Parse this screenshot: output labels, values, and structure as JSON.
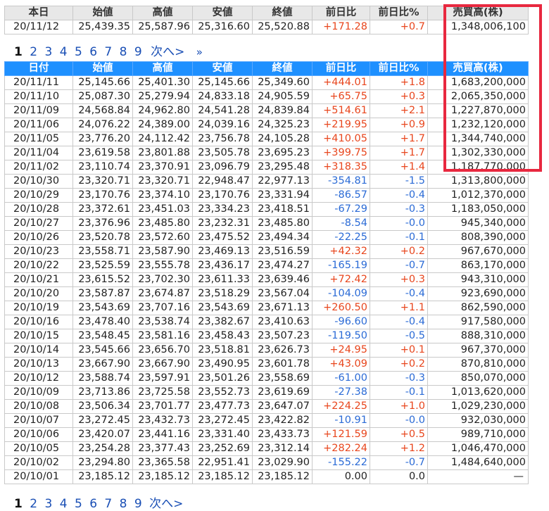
{
  "today": {
    "headers": [
      "本日",
      "始値",
      "高値",
      "安値",
      "終値",
      "前日比",
      "前日比%",
      "売買高(株)"
    ],
    "row": [
      "20/11/12",
      "25,439.35",
      "25,587.96",
      "25,316.60",
      "25,520.88",
      "+171.28",
      "+0.7",
      "1,348,006,100"
    ]
  },
  "pager": {
    "pages": [
      "1",
      "2",
      "3",
      "4",
      "5",
      "6",
      "7",
      "8",
      "9"
    ],
    "current": "1",
    "next": "次へ>",
    "last": "»"
  },
  "pager_bottom": {
    "pages": [
      "1",
      "2",
      "3",
      "4",
      "5",
      "6",
      "7",
      "8",
      "9"
    ],
    "next": "次へ>"
  },
  "history": {
    "headers": [
      "日付",
      "始値",
      "高値",
      "安値",
      "終値",
      "前日比",
      "前日比%",
      "売買高(株)"
    ],
    "rows": [
      [
        "20/11/11",
        "25,145.66",
        "25,401.30",
        "25,145.66",
        "25,349.60",
        "+444.01",
        "+1.8",
        "1,683,200,000"
      ],
      [
        "20/11/10",
        "25,087.30",
        "25,279.94",
        "24,833.18",
        "24,905.59",
        "+65.75",
        "+0.3",
        "2,065,350,000"
      ],
      [
        "20/11/09",
        "24,568.84",
        "24,962.80",
        "24,541.28",
        "24,839.84",
        "+514.61",
        "+2.1",
        "1,227,870,000"
      ],
      [
        "20/11/06",
        "24,076.22",
        "24,389.00",
        "24,039.16",
        "24,325.23",
        "+219.95",
        "+0.9",
        "1,232,120,000"
      ],
      [
        "20/11/05",
        "23,776.20",
        "24,112.42",
        "23,756.78",
        "24,105.28",
        "+410.05",
        "+1.7",
        "1,344,740,000"
      ],
      [
        "20/11/04",
        "23,619.58",
        "23,801.88",
        "23,505.78",
        "23,695.23",
        "+399.75",
        "+1.7",
        "1,302,330,000"
      ],
      [
        "20/11/02",
        "23,110.74",
        "23,370.91",
        "23,096.79",
        "23,295.48",
        "+318.35",
        "+1.4",
        "1,187,770,000"
      ],
      [
        "20/10/30",
        "23,320.71",
        "23,320.71",
        "22,948.47",
        "22,977.13",
        "-354.81",
        "-1.5",
        "1,313,800,000"
      ],
      [
        "20/10/29",
        "23,170.76",
        "23,374.10",
        "23,170.76",
        "23,331.94",
        "-86.57",
        "-0.4",
        "1,012,370,000"
      ],
      [
        "20/10/28",
        "23,372.61",
        "23,451.03",
        "23,334.23",
        "23,418.51",
        "-67.29",
        "-0.3",
        "1,183,050,000"
      ],
      [
        "20/10/27",
        "23,376.96",
        "23,485.80",
        "23,232.31",
        "23,485.80",
        "-8.54",
        "-0.0",
        "945,340,000"
      ],
      [
        "20/10/26",
        "23,520.78",
        "23,572.60",
        "23,475.52",
        "23,494.34",
        "-22.25",
        "-0.1",
        "808,390,000"
      ],
      [
        "20/10/23",
        "23,558.71",
        "23,587.90",
        "23,469.13",
        "23,516.59",
        "+42.32",
        "+0.2",
        "967,670,000"
      ],
      [
        "20/10/22",
        "23,525.59",
        "23,555.78",
        "23,436.17",
        "23,474.27",
        "-165.19",
        "-0.7",
        "863,170,000"
      ],
      [
        "20/10/21",
        "23,615.52",
        "23,702.30",
        "23,611.33",
        "23,639.46",
        "+72.42",
        "+0.3",
        "943,310,000"
      ],
      [
        "20/10/20",
        "23,587.87",
        "23,674.87",
        "23,518.29",
        "23,567.04",
        "-104.09",
        "-0.4",
        "923,690,000"
      ],
      [
        "20/10/19",
        "23,543.69",
        "23,707.16",
        "23,543.69",
        "23,671.13",
        "+260.50",
        "+1.1",
        "862,590,000"
      ],
      [
        "20/10/16",
        "23,478.40",
        "23,538.74",
        "23,382.67",
        "23,410.63",
        "-96.60",
        "-0.4",
        "917,580,000"
      ],
      [
        "20/10/15",
        "23,548.45",
        "23,581.16",
        "23,458.43",
        "23,507.23",
        "-119.50",
        "-0.5",
        "888,310,000"
      ],
      [
        "20/10/14",
        "23,545.66",
        "23,656.70",
        "23,518.81",
        "23,626.73",
        "+24.95",
        "+0.1",
        "967,370,000"
      ],
      [
        "20/10/13",
        "23,667.90",
        "23,667.90",
        "23,490.95",
        "23,601.78",
        "+43.09",
        "+0.2",
        "870,810,000"
      ],
      [
        "20/10/12",
        "23,588.74",
        "23,597.91",
        "23,501.26",
        "23,558.69",
        "-61.00",
        "-0.3",
        "850,070,000"
      ],
      [
        "20/10/09",
        "23,713.86",
        "23,725.58",
        "23,552.73",
        "23,619.69",
        "-27.38",
        "-0.1",
        "1,013,620,000"
      ],
      [
        "20/10/08",
        "23,506.34",
        "23,701.77",
        "23,477.73",
        "23,647.07",
        "+224.25",
        "+1.0",
        "1,029,230,000"
      ],
      [
        "20/10/07",
        "23,272.45",
        "23,432.73",
        "23,272.45",
        "23,422.82",
        "-10.91",
        "-0.0",
        "932,030,000"
      ],
      [
        "20/10/06",
        "23,420.07",
        "23,441.16",
        "23,331.40",
        "23,433.73",
        "+121.59",
        "+0.5",
        "989,710,000"
      ],
      [
        "20/10/05",
        "23,254.28",
        "23,377.43",
        "23,252.69",
        "23,312.14",
        "+282.24",
        "+1.2",
        "1,046,470,000"
      ],
      [
        "20/10/02",
        "23,294.80",
        "23,365.58",
        "22,951.41",
        "23,029.90",
        "-155.22",
        "-0.7",
        "1,484,640,000"
      ],
      [
        "20/10/01",
        "23,185.12",
        "23,185.12",
        "23,185.12",
        "23,185.12",
        "0.00",
        "0.0",
        "—"
      ]
    ]
  },
  "colors": {
    "positive": "#e8461d",
    "negative": "#2b6bd6",
    "header_blue": "#1e90ff",
    "highlight_red": "#e8283f"
  }
}
